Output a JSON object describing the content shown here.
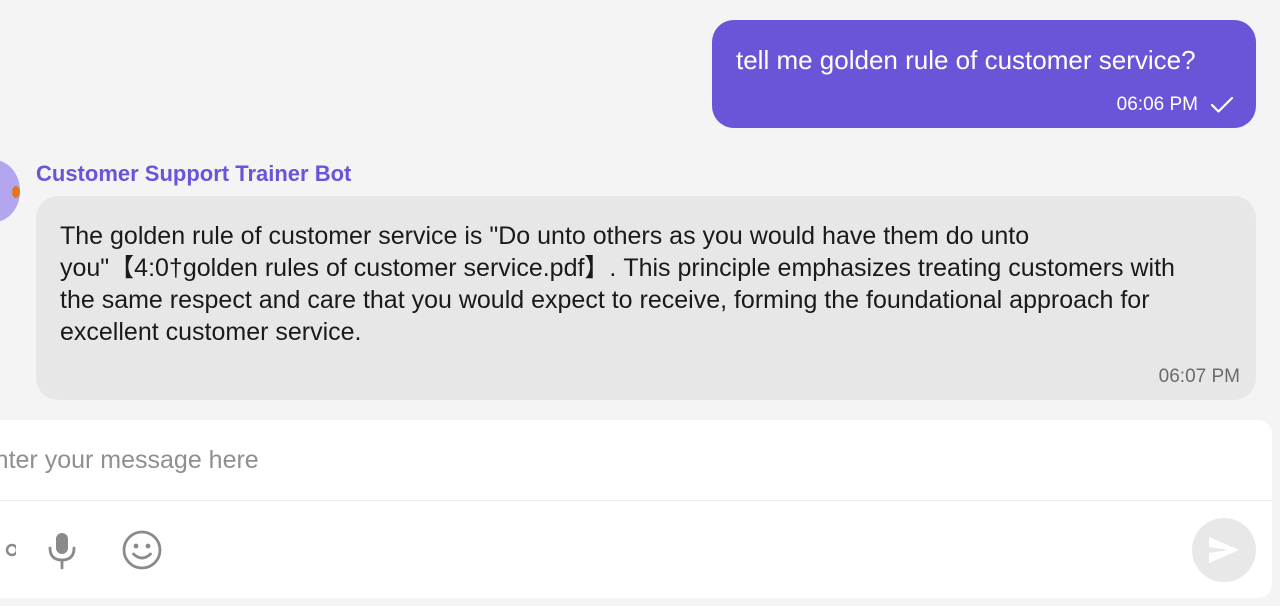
{
  "user_message": {
    "text": "tell me golden rule of customer service?",
    "time": "06:06 PM"
  },
  "bot_message": {
    "sender": "Customer Support Trainer Bot",
    "text": "The golden rule of customer service is \"Do unto others as you would have them do unto you\"【4:0†golden rules of customer service.pdf】. This principle emphasizes treating customers with the same respect and care that you would expect to receive, forming the foundational approach for excellent customer service.",
    "time": "06:07 PM"
  },
  "composer": {
    "placeholder": "Enter your message here",
    "icons": [
      "attachment-icon",
      "microphone-icon",
      "emoji-icon",
      "send-icon"
    ]
  },
  "colors": {
    "accent": "#6a55d8",
    "background": "#f4f4f5",
    "bot_bubble": "#e7e7e8"
  }
}
